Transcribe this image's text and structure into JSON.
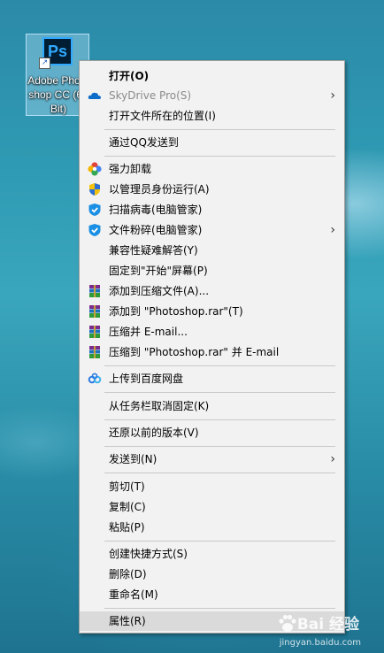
{
  "desktop_icon": {
    "logo_text": "Ps",
    "label": "Adobe Photoshop CC (64 Bit)"
  },
  "menu": {
    "items": [
      {
        "label": "打开(O)",
        "bold": true
      },
      {
        "label": "SkyDrive Pro(S)",
        "disabled": true,
        "submenu": true,
        "icon": "onedrive-icon"
      },
      {
        "label": "打开文件所在的位置(I)"
      },
      {
        "label": "通过QQ发送到"
      },
      {
        "label": "强力卸载",
        "icon": "uninstall-icon"
      },
      {
        "label": "以管理员身份运行(A)",
        "icon": "uac-shield-icon"
      },
      {
        "label": "扫描病毒(电脑管家)",
        "icon": "tencent-pc-manager-icon"
      },
      {
        "label": "文件粉碎(电脑管家)",
        "icon": "tencent-pc-manager-icon",
        "submenu": true
      },
      {
        "label": "兼容性疑难解答(Y)"
      },
      {
        "label": "固定到\"开始\"屏幕(P)"
      },
      {
        "label": "添加到压缩文件(A)...",
        "icon": "winrar-icon"
      },
      {
        "label": "添加到 \"Photoshop.rar\"(T)",
        "icon": "winrar-icon"
      },
      {
        "label": "压缩并 E-mail...",
        "icon": "winrar-icon"
      },
      {
        "label": "压缩到 \"Photoshop.rar\" 并 E-mail",
        "icon": "winrar-icon"
      },
      {
        "label": "上传到百度网盘",
        "icon": "baidu-netdisk-icon"
      },
      {
        "label": "从任务栏取消固定(K)"
      },
      {
        "label": "还原以前的版本(V)"
      },
      {
        "label": "发送到(N)",
        "submenu": true
      },
      {
        "label": "剪切(T)"
      },
      {
        "label": "复制(C)"
      },
      {
        "label": "粘贴(P)"
      },
      {
        "label": "创建快捷方式(S)"
      },
      {
        "label": "删除(D)"
      },
      {
        "label": "重命名(M)"
      },
      {
        "label": "属性(R)",
        "highlighted": true
      }
    ]
  },
  "watermark": {
    "brand": "Bai 经验",
    "url": "jingyan.baidu.com"
  },
  "colors": {
    "menu_bg": "#f2f2f2",
    "highlight": "#dadada",
    "desktop": "#2f9ab3"
  }
}
